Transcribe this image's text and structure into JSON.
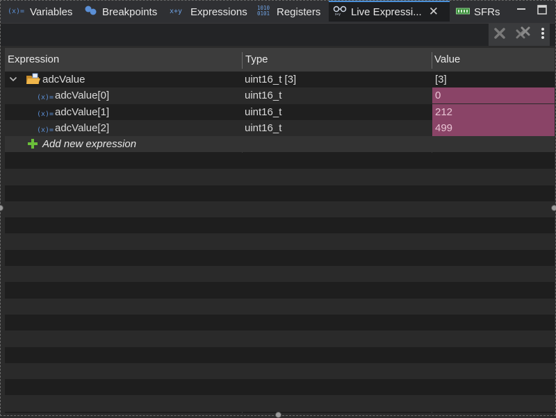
{
  "tabs": [
    {
      "label": "Variables",
      "icon": "variables-icon"
    },
    {
      "label": "Breakpoints",
      "icon": "breakpoints-icon"
    },
    {
      "label": "Expressions",
      "icon": "expressions-icon"
    },
    {
      "label": "Registers",
      "icon": "registers-icon"
    },
    {
      "label": "Live Expressi...",
      "icon": "live-expressions-icon",
      "active": true
    },
    {
      "label": "SFRs",
      "icon": "sfrs-icon"
    }
  ],
  "table": {
    "headers": {
      "expression": "Expression",
      "type": "Type",
      "value": "Value"
    },
    "rows": [
      {
        "expression": "adcValue",
        "type": "uint16_t [3]",
        "value": "[3]",
        "level": 0,
        "expanded": true,
        "icon": "folder-icon"
      },
      {
        "expression": "adcValue[0]",
        "type": "uint16_t",
        "value": "0",
        "level": 1,
        "icon": "variable-icon",
        "changed": true
      },
      {
        "expression": "adcValue[1]",
        "type": "uint16_t",
        "value": "212",
        "level": 1,
        "icon": "variable-icon",
        "changed": true
      },
      {
        "expression": "adcValue[2]",
        "type": "uint16_t",
        "value": "499",
        "level": 1,
        "icon": "variable-icon",
        "changed": true
      }
    ],
    "add_new": "Add new expression"
  },
  "colors": {
    "accent": "#4a90d9",
    "changed_bg": "#8a4467",
    "add_green": "#6bbf3a"
  }
}
